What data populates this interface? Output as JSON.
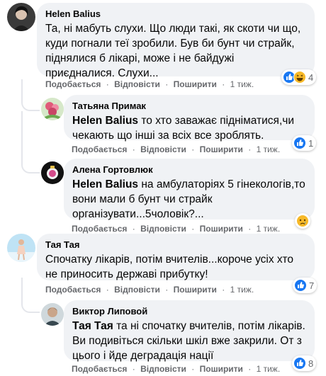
{
  "comments": [
    {
      "author": "Helen Balius",
      "text": "Та, ні мабуть слухи. Що люди такі, як скоти чи що, куди погнали теї зробили. Був би бунт чи страйк, піднялися б лікарі, може і не байдужі приєдналися. Слухи...",
      "reactions": {
        "icons": [
          "like-icon",
          "haha-icon"
        ],
        "count": "4"
      },
      "like_label": "Подобається",
      "reply_label": "Відповісти",
      "share_label": "Поширити",
      "time": "1 тиж."
    },
    {
      "author": "Татьяна Примак",
      "mention": "Helen Balius",
      "text": " то хто заважає підніматися,чи чекають що інші за всіх все зроблять.",
      "reactions": {
        "icons": [
          "like-icon"
        ],
        "count": "1"
      },
      "like_label": "Подобається",
      "reply_label": "Відповісти",
      "share_label": "Поширити",
      "time": "1 тиж."
    },
    {
      "author": "Алена Гортовлюк",
      "mention": "Helen Balius",
      "text": " на амбулаторіях 5 гінекологів,то вони мали б бунт чи страйк організувати...5чоловік?...",
      "reactions": {
        "icons": [
          "sad-icon"
        ],
        "count": ""
      },
      "like_label": "Подобається",
      "reply_label": "Відповісти",
      "share_label": "Поширити",
      "time": "1 тиж."
    },
    {
      "author": "Тая Тая",
      "text": "Спочатку лікарів, потім вчителів...короче усіх хто не приносить державі прибутку!",
      "reactions": {
        "icons": [
          "like-icon"
        ],
        "count": "7"
      },
      "like_label": "Подобається",
      "reply_label": "Відповісти",
      "share_label": "Поширити",
      "time": "1 тиж."
    },
    {
      "author": "Виктор Липовой",
      "mention": "Тая Тая",
      "text": " та ні спочатку вчителів, потім лікарів. Ви подивіться скільки шкіл вже закрили. От з цього і йде деградація нації",
      "reactions": {
        "icons": [
          "like-icon"
        ],
        "count": "8"
      },
      "like_label": "Подобається",
      "reply_label": "Відповісти",
      "share_label": "Поширити",
      "time": "1 тиж."
    }
  ],
  "separator": "·",
  "colors": {
    "bubble": "#f0f2f5",
    "secondary_text": "#65676b",
    "like_blue": "#1877f2",
    "emoji_yellow": "#f7b928"
  }
}
